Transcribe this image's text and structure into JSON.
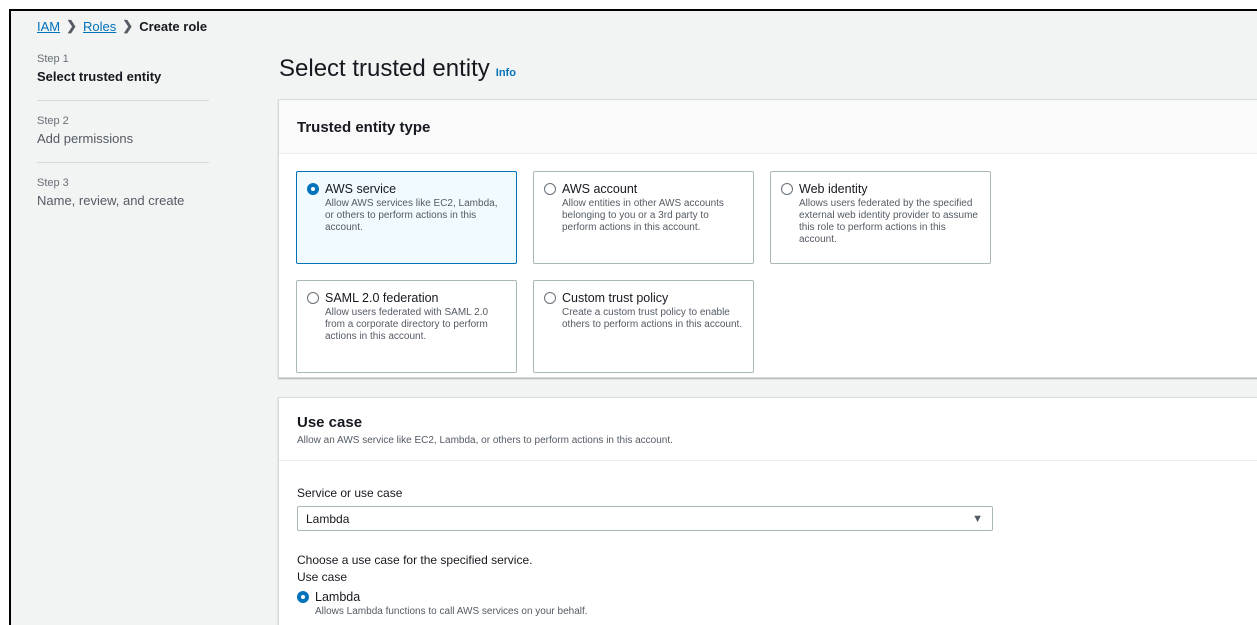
{
  "breadcrumb": {
    "items": [
      "IAM",
      "Roles"
    ],
    "current": "Create role",
    "separator": "❯"
  },
  "steps": [
    {
      "num": "Step 1",
      "title": "Select trusted entity"
    },
    {
      "num": "Step 2",
      "title": "Add permissions"
    },
    {
      "num": "Step 3",
      "title": "Name, review, and create"
    }
  ],
  "page": {
    "title": "Select trusted entity",
    "info": "Info"
  },
  "trusted": {
    "header": "Trusted entity type",
    "tiles": [
      {
        "title": "AWS service",
        "desc": "Allow AWS services like EC2, Lambda, or others to perform actions in this account."
      },
      {
        "title": "AWS account",
        "desc": "Allow entities in other AWS accounts belonging to you or a 3rd party to perform actions in this account."
      },
      {
        "title": "Web identity",
        "desc": "Allows users federated by the specified external web identity provider to assume this role to perform actions in this account."
      },
      {
        "title": "SAML 2.0 federation",
        "desc": "Allow users federated with SAML 2.0 from a corporate directory to perform actions in this account."
      },
      {
        "title": "Custom trust policy",
        "desc": "Create a custom trust policy to enable others to perform actions in this account."
      }
    ],
    "selected": "AWS service"
  },
  "usecase": {
    "title": "Use case",
    "desc": "Allow an AWS service like EC2, Lambda, or others to perform actions in this account.",
    "field_label": "Service or use case",
    "selected_value": "Lambda",
    "arrow": "▼",
    "choose_desc": "Choose a use case for the specified service.",
    "label": "Use case",
    "option_title": "Lambda",
    "option_desc": "Allows Lambda functions to call AWS services on your behalf."
  },
  "colors": {
    "accent": "#0073bb",
    "selected_bg": "#f1faff",
    "page_bg": "#f2f3f3"
  }
}
